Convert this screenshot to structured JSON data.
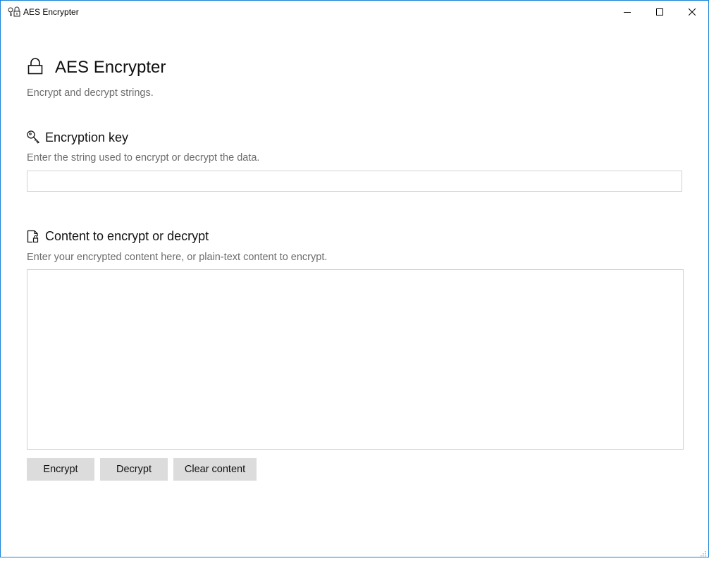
{
  "window": {
    "title": "AES Encrypter",
    "app_icon": "key-lock-icon",
    "controls": {
      "minimize": "minimize-icon",
      "maximize": "maximize-icon",
      "close": "close-icon"
    },
    "border_color": "#1883d7"
  },
  "header": {
    "icon": "lock-icon",
    "title": "AES Encrypter",
    "subtitle": "Encrypt and decrypt strings."
  },
  "key_section": {
    "icon": "key-icon",
    "title": "Encryption key",
    "description": "Enter the string used to encrypt or decrypt the data.",
    "value": "",
    "placeholder": ""
  },
  "content_section": {
    "icon": "document-lock-icon",
    "title": "Content to encrypt or decrypt",
    "description": "Enter your encrypted content here, or plain-text content to encrypt.",
    "value": "",
    "placeholder": ""
  },
  "actions": {
    "encrypt_label": "Encrypt",
    "decrypt_label": "Decrypt",
    "clear_label": "Clear content"
  },
  "colors": {
    "button_bg": "#dcdcdc",
    "muted_text": "#6d6d6d",
    "input_border": "#d2d2d2"
  }
}
